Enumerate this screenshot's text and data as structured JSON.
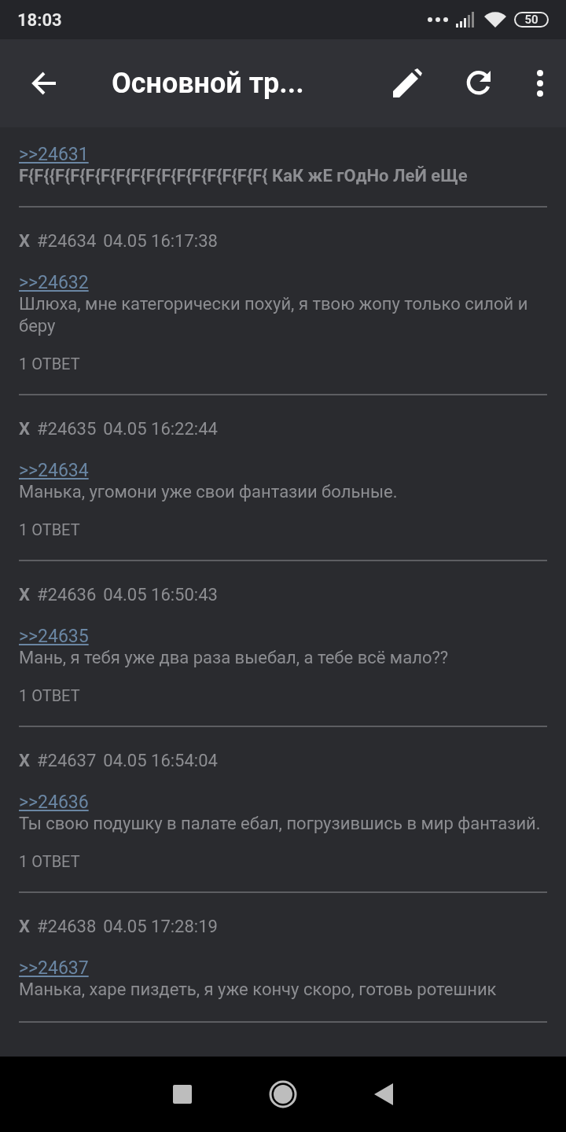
{
  "status_bar": {
    "time": "18:03",
    "battery": "50"
  },
  "app_bar": {
    "title": "Основной тр..."
  },
  "posts": [
    {
      "reply_to": ">>24631",
      "text": "F{F{{F{F{F{F{F{F{F{F{F{F{F{F{F{F{ КаК жЕ гОдНо ЛеЙ еЩе",
      "bold": true
    },
    {
      "marker": "X",
      "number": "#24634",
      "date": "04.05 16:17:38",
      "reply_to": ">>24632",
      "text": "Шлюха, мне категорически похуй, я твою жопу только силой и беру",
      "bold": false,
      "replies": "1 ОТВЕТ"
    },
    {
      "marker": "X",
      "number": "#24635",
      "date": "04.05 16:22:44",
      "reply_to": ">>24634",
      "text": "Манька, угомони уже свои фантазии больные.",
      "bold": false,
      "replies": "1 ОТВЕТ"
    },
    {
      "marker": "X",
      "number": "#24636",
      "date": "04.05 16:50:43",
      "reply_to": ">>24635",
      "text": "Мань, я тебя уже два раза выебал, а тебе всё мало??",
      "bold": false,
      "replies": "1 ОТВЕТ"
    },
    {
      "marker": "X",
      "number": "#24637",
      "date": "04.05 16:54:04",
      "reply_to": ">>24636",
      "text": "Ты свою подушку в палате ебал, погрузившись в мир фантазий.",
      "bold": false,
      "replies": "1 ОТВЕТ"
    },
    {
      "marker": "X",
      "number": "#24638",
      "date": "04.05 17:28:19",
      "reply_to": ">>24637",
      "text": "Манька, харе пиздеть, я уже кончу скоро, готовь ротешник",
      "bold": false
    }
  ]
}
